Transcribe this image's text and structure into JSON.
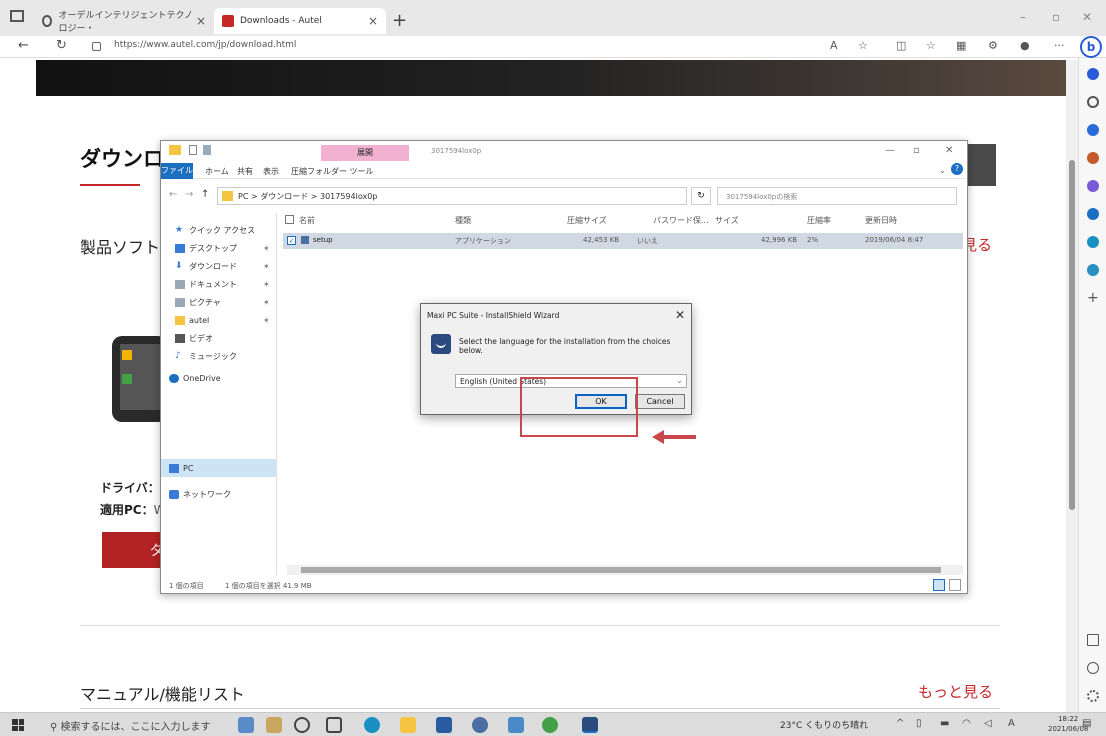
{
  "browser": {
    "tabs": [
      {
        "label": "オーデルインテリジェントテクノロジー・"
      },
      {
        "label": "Downloads - Autel"
      }
    ],
    "url": "https://www.autel.com/jp/download.html",
    "ai_button": "b"
  },
  "page": {
    "title": "ダウンロ",
    "section_software": "製品ソフト",
    "see_more": "見る",
    "driver_label": "ドライバ：",
    "pc_label": "適用PC：",
    "pc_value": "W",
    "download_btn": "ダ",
    "manual_title": "マニュアル/機能リスト",
    "manual_more": "もっと見る"
  },
  "explorer": {
    "ribbon_context": "展開",
    "folder_title": "3017594lox0p",
    "menu": [
      "ファイル",
      "ホーム",
      "共有",
      "表示",
      "圧縮フォルダー ツール"
    ],
    "path": "PC > ダウンロード > 3017594lox0p",
    "search_placeholder": "3017594lox0pの検索",
    "sidebar": [
      {
        "label": "クイック アクセス",
        "color": "#3a7bd5"
      },
      {
        "label": "デスクトップ",
        "color": "#3a7bd5",
        "pin": "✶"
      },
      {
        "label": "ダウンロード",
        "color": "#3a7bd5",
        "pin": "✶"
      },
      {
        "label": "ドキュメント",
        "color": "#9aa8b8",
        "pin": "✶"
      },
      {
        "label": "ピクチャ",
        "color": "#9aa8b8",
        "pin": "✶"
      },
      {
        "label": "autel",
        "color": "#f5c542",
        "pin": "✶"
      },
      {
        "label": "ビデオ",
        "color": "#555555"
      },
      {
        "label": "ミュージック",
        "color": "#3a7bd5"
      },
      {
        "label": "OneDrive",
        "color": "#1a6fc1"
      },
      {
        "label": "PC",
        "color": "#3a7bd5"
      },
      {
        "label": "ネットワーク",
        "color": "#3a7bd5"
      }
    ],
    "columns": [
      "名前",
      "種類",
      "圧縮サイズ",
      "パスワード保...",
      "サイズ",
      "圧縮率",
      "更新日時"
    ],
    "row": {
      "name": "setup",
      "type": "アプリケーション",
      "compressed": "42,453 KB",
      "password": "いいえ",
      "size": "42,996 KB",
      "ratio": "2%",
      "modified": "2019/06/04 8:47"
    },
    "status_items": "1 個の項目",
    "status_selected": "1 個の項目を選択 41.9 MB"
  },
  "dialog": {
    "title": "Maxi PC Suite - InstallShield Wizard",
    "message": "Select the language for the installation from the choices below.",
    "language": "English (United States)",
    "ok": "OK",
    "cancel": "Cancel"
  },
  "taskbar": {
    "search": "検索するには、ここに入力します",
    "weather": "23°C くもりのち晴れ",
    "ime": "A",
    "time": "18:22",
    "date": "2021/06/08"
  },
  "colors": {
    "accent": "#c62828",
    "highlight": "#c8474a",
    "explorer_blue": "#1a6fc1"
  }
}
